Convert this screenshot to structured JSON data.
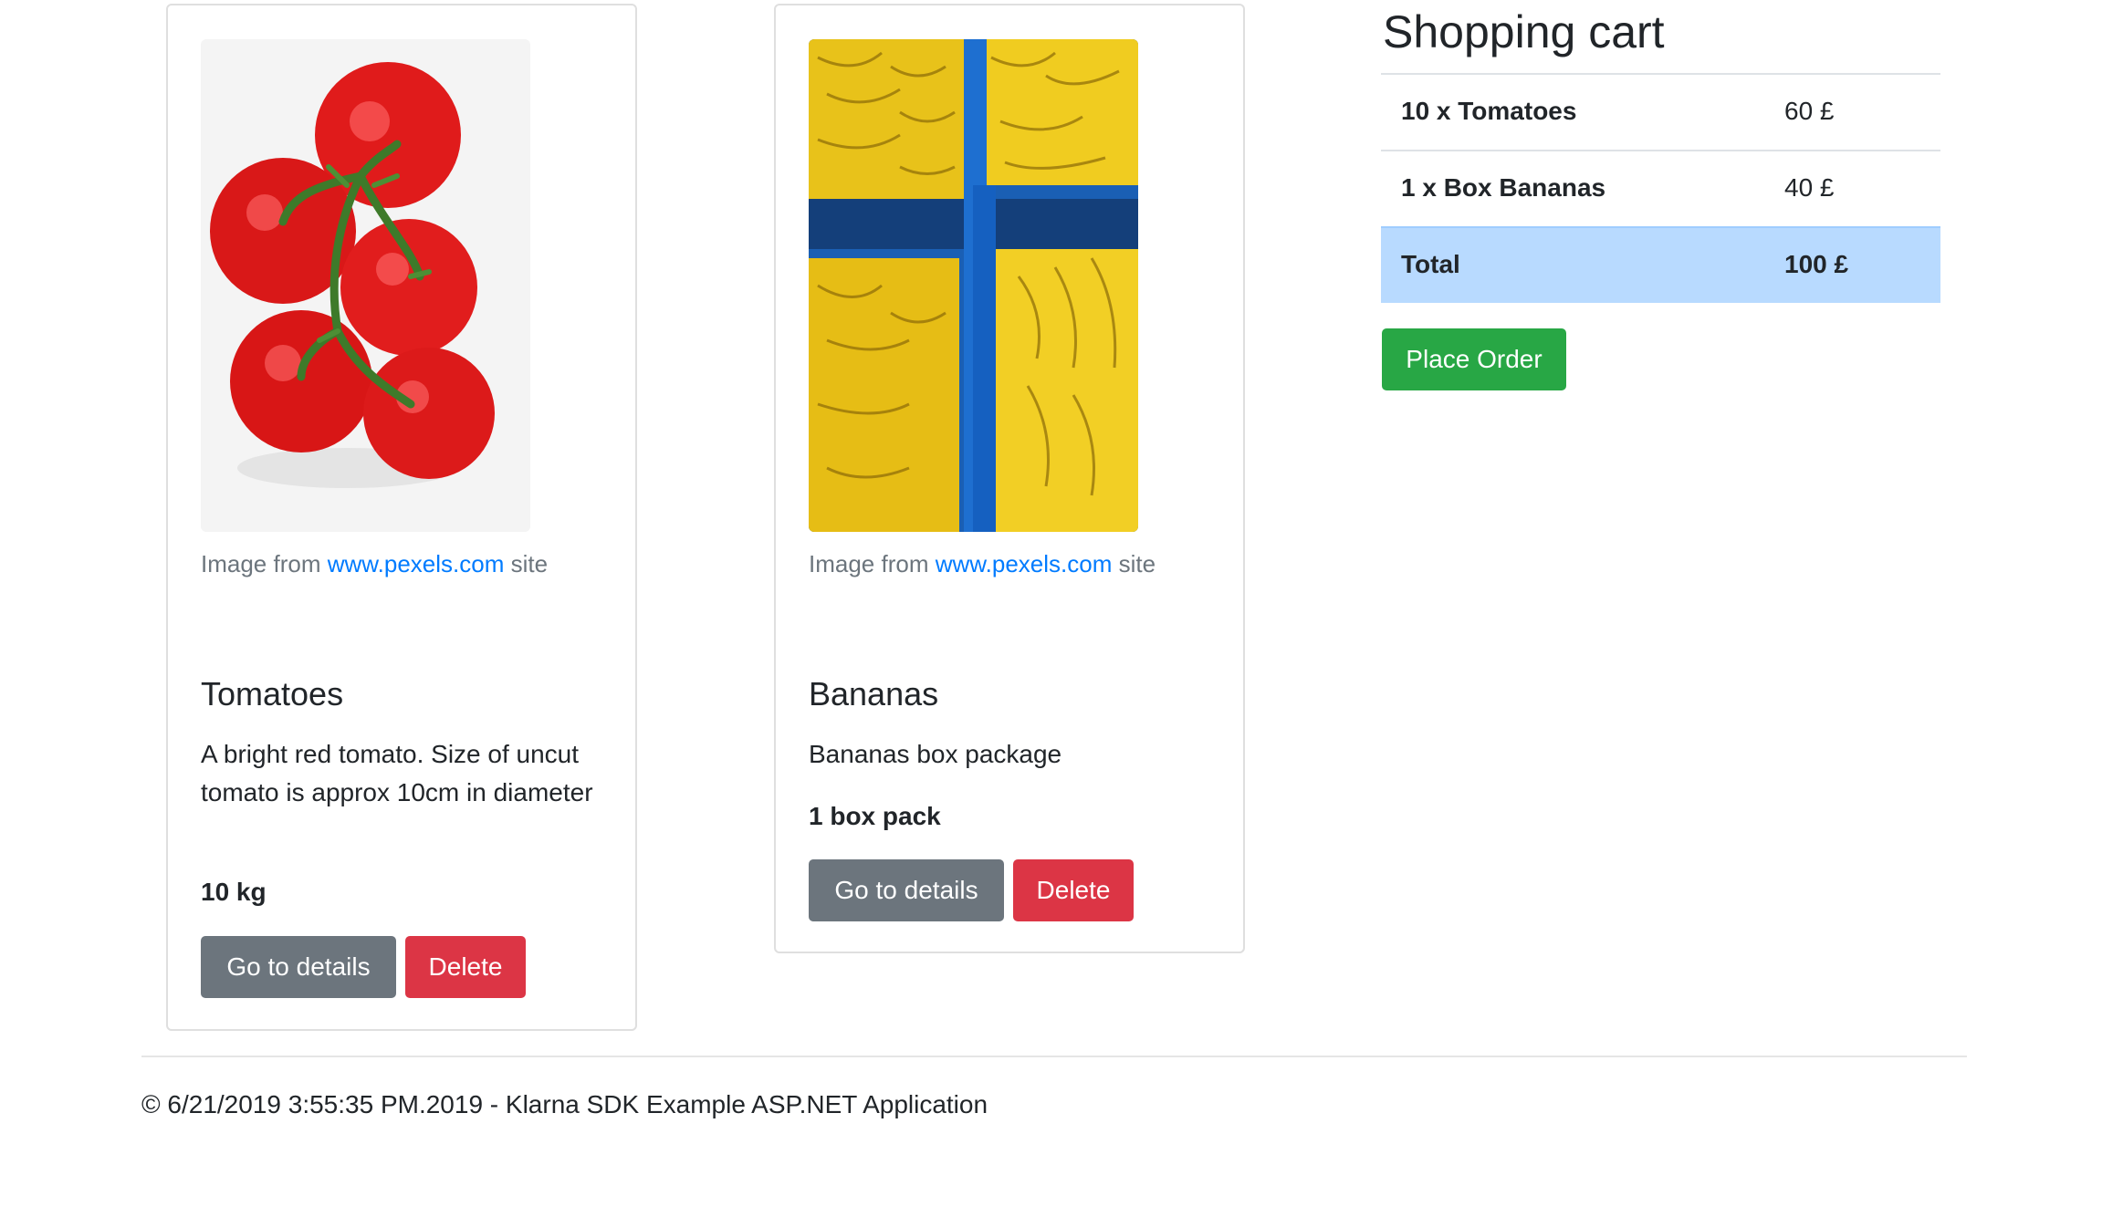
{
  "products": [
    {
      "image_credit_prefix": "Image from",
      "image_credit_link": "www.pexels.com",
      "image_credit_suffix": "site",
      "title": "Tomatoes",
      "description": "A bright red tomato. Size of uncut tomato is approx 10cm in diameter",
      "quantity": "10 kg",
      "details_label": "Go to details",
      "delete_label": "Delete"
    },
    {
      "image_credit_prefix": "Image from",
      "image_credit_link": "www.pexels.com",
      "image_credit_suffix": "site",
      "title": "Bananas",
      "description": "Bananas box package",
      "quantity": "1 box pack",
      "details_label": "Go to details",
      "delete_label": "Delete"
    }
  ],
  "cart": {
    "title": "Shopping cart",
    "items": [
      {
        "label": "10 x Tomatoes",
        "price": "60 £"
      },
      {
        "label": "1 x Box Bananas",
        "price": "40 £"
      }
    ],
    "total_label": "Total",
    "total_price": "100 £",
    "place_order_label": "Place Order"
  },
  "footer": {
    "text": "© 6/21/2019 3:55:35 PM.2019 - Klarna SDK Example ASP.NET Application"
  },
  "colors": {
    "link": "#007bff",
    "secondary": "#6c757d",
    "danger": "#dc3545",
    "success": "#28a745",
    "total_row": "#b8daff"
  }
}
